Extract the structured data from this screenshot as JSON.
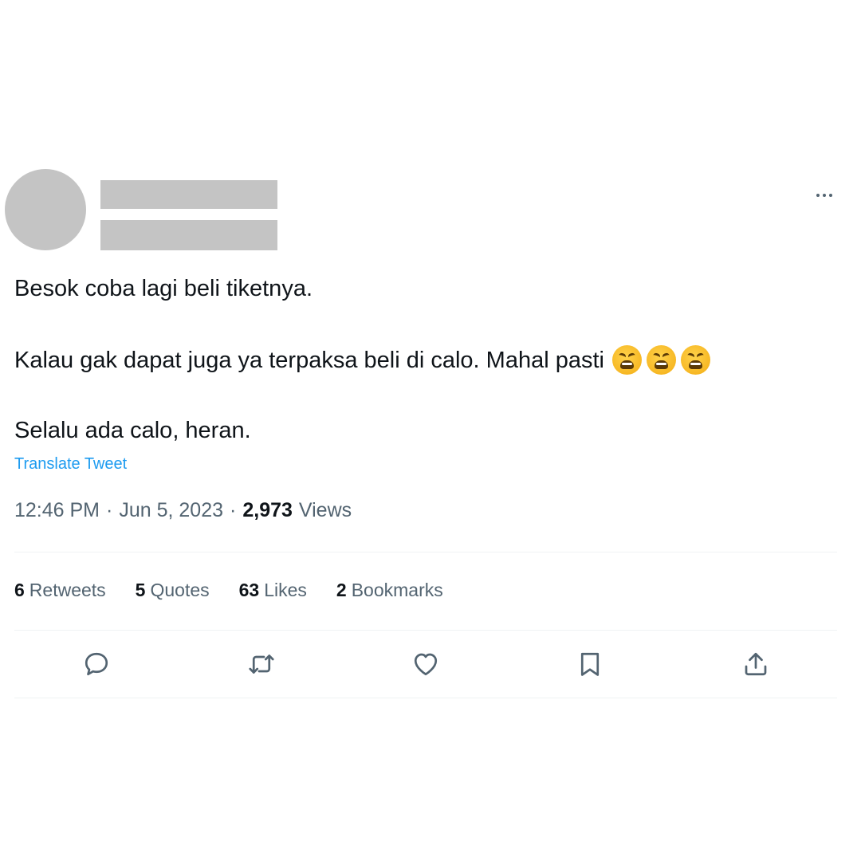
{
  "tweet": {
    "lines": [
      "Besok coba lagi beli tiketnya.",
      "Kalau gak dapat juga ya terpaksa beli di calo. Mahal pasti",
      "Selalu ada calo, heran."
    ],
    "emojis": [
      "weary-face",
      "weary-face",
      "weary-face"
    ],
    "translate_label": "Translate Tweet"
  },
  "meta": {
    "time": "12:46 PM",
    "separator": "·",
    "date": "Jun 5, 2023",
    "views_count": "2,973",
    "views_label": "Views"
  },
  "stats": {
    "retweets": {
      "count": "6",
      "label": "Retweets"
    },
    "quotes": {
      "count": "5",
      "label": "Quotes"
    },
    "likes": {
      "count": "63",
      "label": "Likes"
    },
    "bookmarks": {
      "count": "2",
      "label": "Bookmarks"
    }
  },
  "actions": [
    "reply-icon",
    "retweet-icon",
    "like-icon",
    "bookmark-icon",
    "share-icon"
  ],
  "colors": {
    "link": "#1d9bf0",
    "secondary_text": "#536471",
    "primary_text": "#0f1419",
    "redaction": "#c4c4c4",
    "divider": "#eff3f4"
  }
}
